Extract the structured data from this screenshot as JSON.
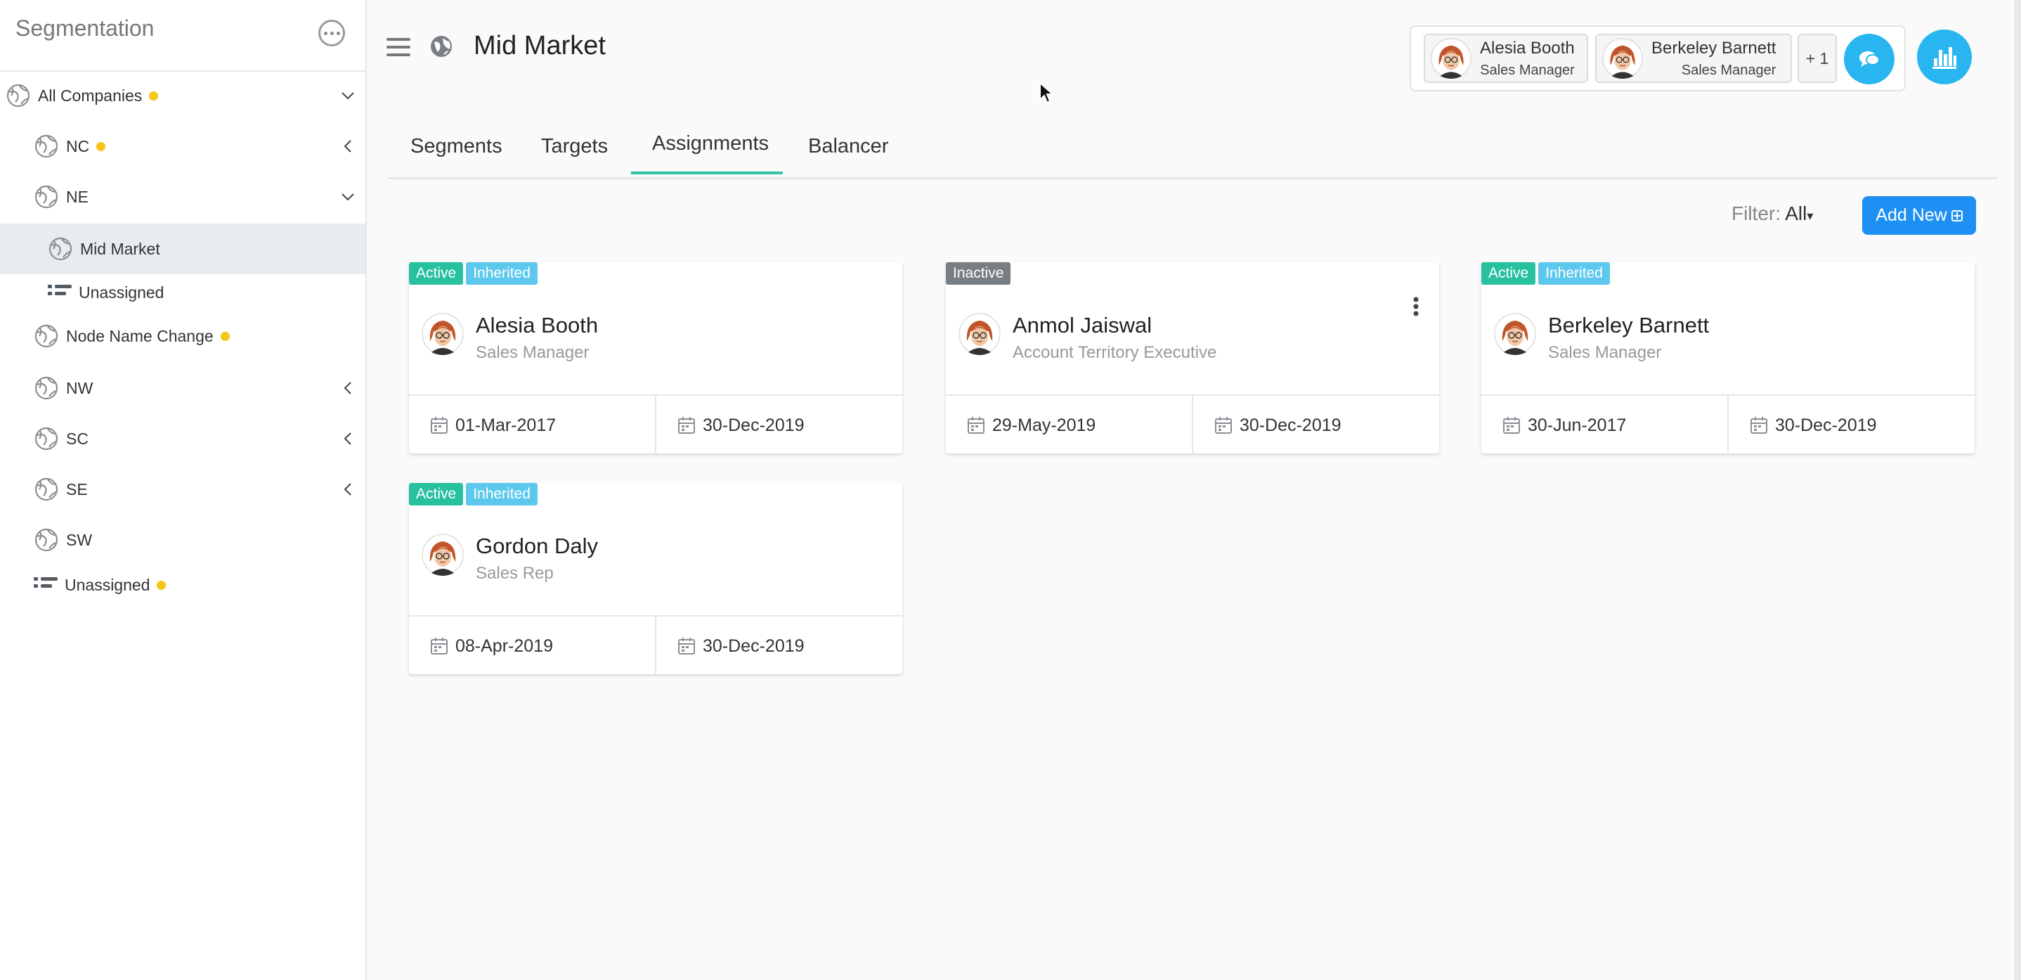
{
  "sidebar": {
    "title": "Segmentation",
    "more_icon": "more-icon",
    "items": [
      {
        "label": "All Companies",
        "dot": true,
        "chevron": "down",
        "icon": "globe-icon"
      },
      {
        "label": "NC",
        "dot": true,
        "chevron": "left",
        "icon": "globe-icon"
      },
      {
        "label": "NE",
        "dot": false,
        "chevron": "down",
        "icon": "globe-icon"
      },
      {
        "label": "Mid Market",
        "dot": false,
        "chevron": "",
        "icon": "globe-icon",
        "selected": true
      },
      {
        "label": "Unassigned",
        "dot": false,
        "chevron": "",
        "icon": "list-icon"
      },
      {
        "label": "Node Name Change",
        "dot": true,
        "chevron": "",
        "icon": "globe-icon"
      },
      {
        "label": "NW",
        "dot": false,
        "chevron": "left",
        "icon": "globe-icon"
      },
      {
        "label": "SC",
        "dot": false,
        "chevron": "left",
        "icon": "globe-icon"
      },
      {
        "label": "SE",
        "dot": false,
        "chevron": "left",
        "icon": "globe-icon"
      },
      {
        "label": "SW",
        "dot": false,
        "chevron": "",
        "icon": "globe-icon"
      },
      {
        "label": "Unassigned",
        "dot": true,
        "chevron": "",
        "icon": "list-icon"
      }
    ]
  },
  "header": {
    "title": "Mid Market",
    "people": [
      {
        "name": "Alesia Booth",
        "role": "Sales Manager"
      },
      {
        "name": "Berkeley Barnett",
        "role": "Sales Manager"
      }
    ],
    "more_count": "+ 1"
  },
  "tabs": [
    "Segments",
    "Targets",
    "Assignments",
    "Balancer"
  ],
  "active_tab": "Assignments",
  "filter": {
    "label": "Filter:",
    "value": "All"
  },
  "add_button": "Add New",
  "cards": [
    {
      "badges": [
        "Active",
        "Inherited"
      ],
      "name": "Alesia Booth",
      "role": "Sales Manager",
      "start": "01-Mar-2017",
      "end": "30-Dec-2019"
    },
    {
      "badges": [
        "Inactive"
      ],
      "name": "Anmol Jaiswal",
      "role": "Account Territory Executive",
      "start": "29-May-2019",
      "end": "30-Dec-2019"
    },
    {
      "badges": [
        "Active",
        "Inherited"
      ],
      "name": "Berkeley Barnett",
      "role": "Sales Manager",
      "start": "30-Jun-2017",
      "end": "30-Dec-2019"
    },
    {
      "badges": [
        "Active",
        "Inherited"
      ],
      "name": "Gordon Daly",
      "role": "Sales Rep",
      "start": "08-Apr-2019",
      "end": "30-Dec-2019"
    }
  ],
  "colors": {
    "accent": "#29b6f0",
    "button_blue": "#1e90f3",
    "active_badge": "#27c19f",
    "inherited_badge": "#5cc8ee",
    "inactive_badge": "#777e84",
    "dot_yellow": "#f5c518",
    "tab_underline": "#2ec4a4"
  }
}
